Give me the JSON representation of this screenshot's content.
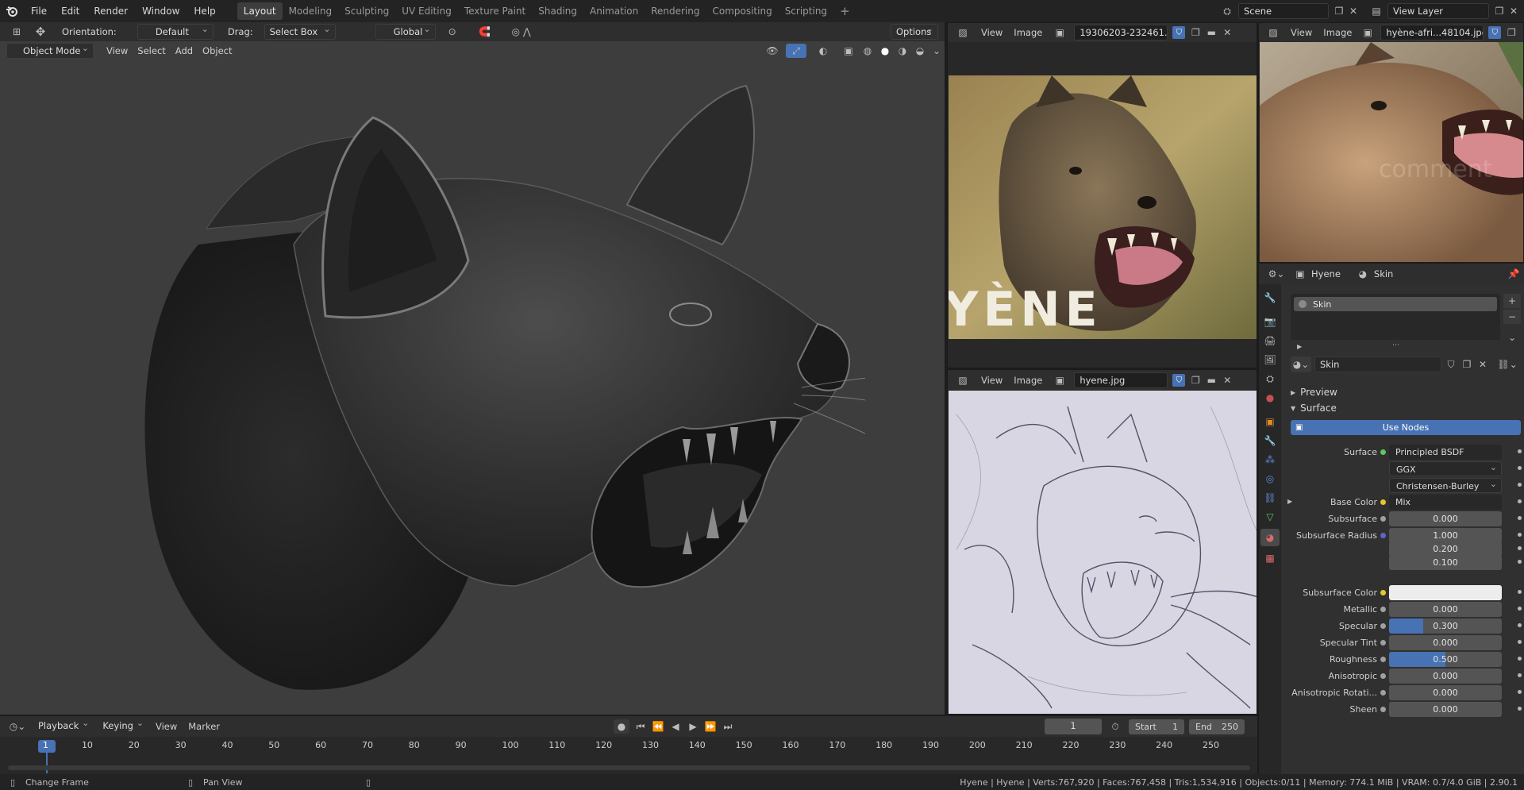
{
  "topbar": {
    "menus": [
      "File",
      "Edit",
      "Render",
      "Window",
      "Help"
    ],
    "workspaces": [
      "Layout",
      "Modeling",
      "Sculpting",
      "UV Editing",
      "Texture Paint",
      "Shading",
      "Animation",
      "Rendering",
      "Compositing",
      "Scripting"
    ],
    "active_workspace": "Layout",
    "add_tab": "+",
    "scene": "Scene",
    "view_layer": "View Layer"
  },
  "tool_header": {
    "orientation_label": "Orientation:",
    "orientation_value": "Default",
    "drag_label": "Drag:",
    "drag_value": "Select Box",
    "transform_value": "Global",
    "options": "Options"
  },
  "viewport_header": {
    "mode": "Object Mode",
    "menus": [
      "View",
      "Select",
      "Add",
      "Object"
    ]
  },
  "image_editor_top": {
    "menus": [
      "View",
      "Image"
    ],
    "image_name": "19306203-232461...",
    "overlay_text": "YÈNE"
  },
  "image_editor_right": {
    "menus": [
      "View",
      "Image"
    ],
    "image_name": "hyène-afri...48104.jpg",
    "watermark": "comment"
  },
  "image_editor_bottom": {
    "menus": [
      "View",
      "Image"
    ],
    "image_name": "hyene.jpg"
  },
  "properties": {
    "object_name": "Hyene",
    "material_name": "Skin",
    "slot_name": "Skin",
    "material_field": "Skin",
    "sections": {
      "preview": "Preview",
      "surface": "Surface"
    },
    "use_nodes": "Use Nodes",
    "rows": [
      {
        "label": "Surface",
        "value": "Principled BSDF",
        "type": "link",
        "dot": "#5fc55f"
      },
      {
        "label": "",
        "value": "GGX",
        "type": "dropdown"
      },
      {
        "label": "",
        "value": "Christensen-Burley",
        "type": "dropdown"
      },
      {
        "label": "Base Color",
        "value": "Mix",
        "type": "link",
        "dot": "#e6c72a"
      },
      {
        "label": "Subsurface",
        "value": "0.000",
        "type": "number",
        "dot": "#a0a0a0",
        "fraction": 0
      },
      {
        "label": "Subsurface Radius",
        "value": "1.000",
        "type": "number",
        "dot": "#6363c7",
        "fraction": 0
      },
      {
        "label": "",
        "value": "0.200",
        "type": "number",
        "fraction": 0
      },
      {
        "label": "",
        "value": "0.100",
        "type": "number",
        "fraction": 0
      },
      {
        "label": "Subsurface Color",
        "value": "",
        "type": "color",
        "dot": "#e6c72a",
        "color": "#ededed"
      },
      {
        "label": "Metallic",
        "value": "0.000",
        "type": "number",
        "dot": "#a0a0a0",
        "fraction": 0
      },
      {
        "label": "Specular",
        "value": "0.300",
        "type": "number",
        "dot": "#a0a0a0",
        "fraction": 0.3
      },
      {
        "label": "Specular Tint",
        "value": "0.000",
        "type": "number",
        "dot": "#a0a0a0",
        "fraction": 0
      },
      {
        "label": "Roughness",
        "value": "0.500",
        "type": "number",
        "dot": "#a0a0a0",
        "fraction": 0.5
      },
      {
        "label": "Anisotropic",
        "value": "0.000",
        "type": "number",
        "dot": "#a0a0a0",
        "fraction": 0
      },
      {
        "label": "Anisotropic Rotati...",
        "value": "0.000",
        "type": "number",
        "dot": "#a0a0a0",
        "fraction": 0
      },
      {
        "label": "Sheen",
        "value": "0.000",
        "type": "number",
        "dot": "#a0a0a0",
        "fraction": 0
      }
    ]
  },
  "timeline": {
    "menus": [
      "Playback",
      "Keying",
      "View",
      "Marker"
    ],
    "current_frame": "1",
    "start_label": "Start",
    "start": "1",
    "end_label": "End",
    "end": "250",
    "ticks": [
      "1",
      "10",
      "20",
      "30",
      "40",
      "50",
      "60",
      "70",
      "80",
      "90",
      "100",
      "110",
      "120",
      "130",
      "140",
      "150",
      "160",
      "170",
      "180",
      "190",
      "200",
      "210",
      "220",
      "230",
      "240",
      "250"
    ]
  },
  "statusbar": {
    "left_hint": "Change Frame",
    "middle_hint": "Pan View",
    "stats": "Hyene | Hyene | Verts:767,920 | Faces:767,458 | Tris:1,534,916 | Objects:0/11 | Memory: 774.1 MiB | VRAM: 0.7/4.0 GiB | 2.90.1"
  },
  "colors": {
    "accent": "#4772b3",
    "bg": "#303030",
    "viewport": "#3d3d3d"
  }
}
